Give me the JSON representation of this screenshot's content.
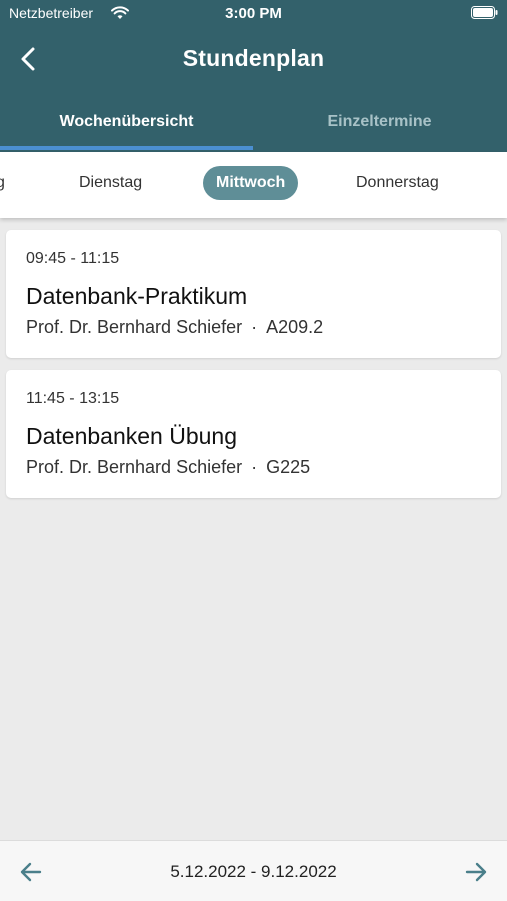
{
  "status": {
    "carrier": "Netzbetreiber",
    "time": "3:00 PM"
  },
  "header": {
    "title": "Stundenplan"
  },
  "tabs": [
    {
      "label": "Wochenübersicht",
      "active": true
    },
    {
      "label": "Einzeltermine",
      "active": false
    }
  ],
  "days": {
    "partial": "g",
    "items": [
      "Dienstag",
      "Mittwoch",
      "Donnerstag"
    ],
    "selected": "Mittwoch"
  },
  "events": [
    {
      "time": "09:45 - 11:15",
      "name": "Datenbank-Praktikum",
      "lecturer": "Prof. Dr. Bernhard Schiefer",
      "separator": "·",
      "room": "A209.2"
    },
    {
      "time": "11:45 - 13:15",
      "name": "Datenbanken Übung",
      "lecturer": "Prof. Dr. Bernhard Schiefer",
      "separator": "·",
      "room": "G225"
    }
  ],
  "footer": {
    "range": "5.12.2022 - 9.12.2022"
  },
  "colors": {
    "header": "#33616b",
    "selected_day": "#5f8e97",
    "tab_indicator": "#4b8fd1",
    "arrow": "#4a7f8a"
  }
}
